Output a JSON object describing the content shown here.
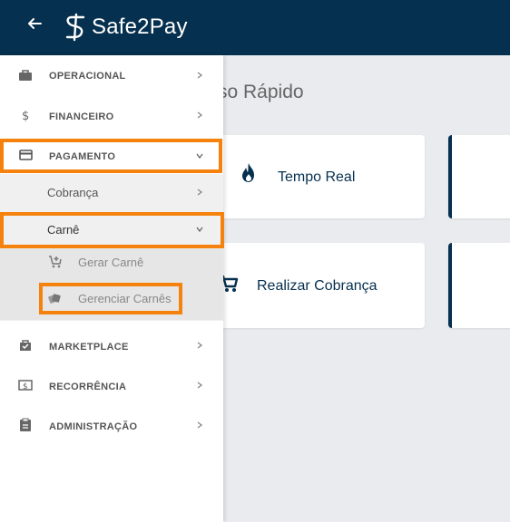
{
  "header": {
    "back_icon": "arrow-left-icon",
    "logo_text": "Safe2Pay",
    "background": "#06304f"
  },
  "main": {
    "title": "so Rápido",
    "cards": [
      {
        "label": "Tempo Real",
        "icon": "flame-icon"
      },
      {
        "label": "Realizar Cobrança",
        "icon": "cart-icon"
      }
    ]
  },
  "sidebar": {
    "items": [
      {
        "label": "OPERACIONAL",
        "icon": "briefcase-icon"
      },
      {
        "label": "FINANCEIRO",
        "icon": "dollar-icon"
      },
      {
        "label": "PAGAMENTO",
        "icon": "credit-card-icon"
      },
      {
        "label": "MARKETPLACE",
        "icon": "shop-bag-icon"
      },
      {
        "label": "RECORRÊNCIA",
        "icon": "money-bill-icon"
      },
      {
        "label": "ADMINISTRAÇÃO",
        "icon": "clipboard-icon"
      }
    ],
    "pagamento_sub": {
      "cobranca": "Cobrança",
      "carne": "Carnê",
      "carne_sub": {
        "gerar": "Gerar Carnê",
        "gerenciar": "Gerenciar Carnês"
      }
    }
  },
  "colors": {
    "brand": "#06304f",
    "highlight": "#f5820d"
  }
}
